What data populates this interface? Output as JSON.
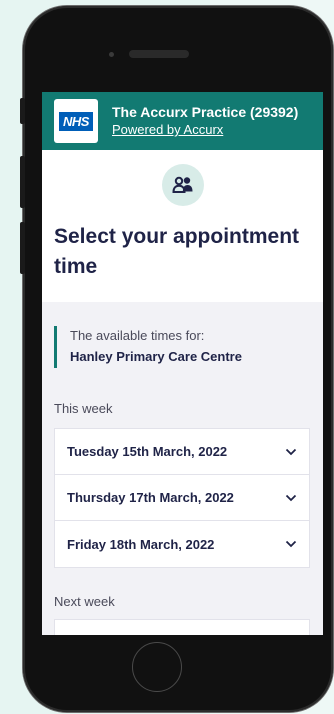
{
  "header": {
    "logo_text": "NHS",
    "practice_name": "The Accurx Practice (29392)",
    "powered_by": "Powered by Accurx"
  },
  "page": {
    "icon": "people-icon",
    "title": "Select your appointment time"
  },
  "availability": {
    "label": "The available times for:",
    "location": "Hanley Primary Care Centre"
  },
  "this_week": {
    "label": "This week",
    "dates": [
      "Tuesday 15th March, 2022",
      "Thursday 17th March, 2022",
      "Friday 18th March, 2022"
    ]
  },
  "next_week": {
    "label": "Next week"
  },
  "colors": {
    "header": "#127a72",
    "nhs_blue": "#005eb8",
    "text_dark": "#1f2347"
  }
}
